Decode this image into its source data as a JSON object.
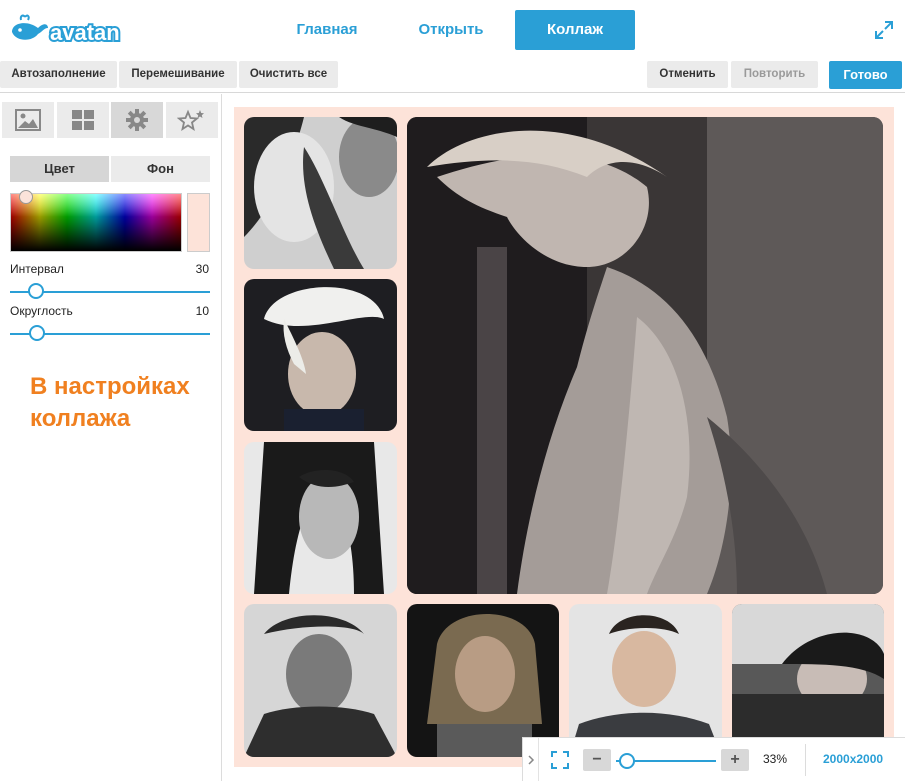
{
  "brand": {
    "logo_text": "avatan",
    "logo_icon": "whale-icon"
  },
  "nav": {
    "home": "Главная",
    "open": "Открыть",
    "collage": "Коллаж"
  },
  "header_icons": {
    "fullscreen": "expand-icon"
  },
  "toolbar": {
    "autofill": "Автозаполнение",
    "shuffle": "Перемешивание",
    "clear_all": "Очистить все",
    "undo": "Отменить",
    "redo": "Повторить",
    "done": "Готово"
  },
  "sidebar": {
    "tabs": [
      {
        "icon": "image-icon"
      },
      {
        "icon": "grid-layout-icon"
      },
      {
        "icon": "gear-icon",
        "active": true
      },
      {
        "icon": "stars-icon"
      }
    ],
    "segment": {
      "color": "Цвет",
      "background": "Фон",
      "selected": "color"
    },
    "selected_color": "#fde3d9",
    "interval": {
      "label": "Интервал",
      "value": "30"
    },
    "roundness": {
      "label": "Округлость",
      "value": "10"
    },
    "promo": "В настройках\nколлажа"
  },
  "canvas": {
    "background_color": "#fde3d9",
    "photo_count": 8
  },
  "zoom": {
    "percent": "33%",
    "size": "2000x2000",
    "fit_icon": "fit-screen-icon",
    "chevron_icon": "chevron-right-icon"
  },
  "colors": {
    "accent": "#2a9fd6",
    "promo": "#f08020"
  }
}
